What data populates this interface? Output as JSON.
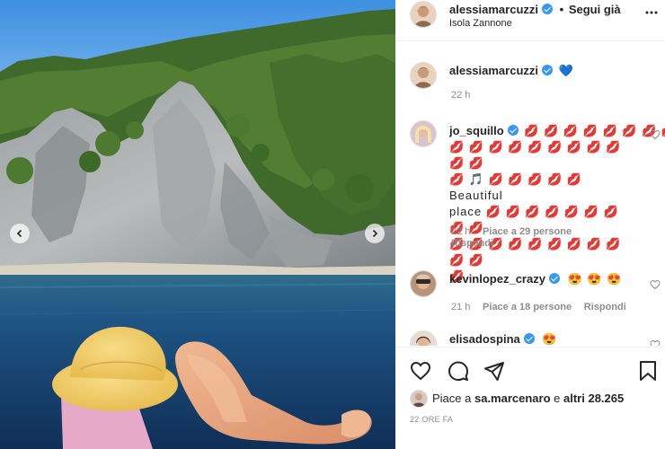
{
  "post": {
    "author": "alessiamarcuzzi",
    "follow_state": "Segui già",
    "dot": "•",
    "location": "Isola Zannone",
    "more_icon": "more-dots-icon"
  },
  "caption": {
    "author": "alessiamarcuzzi",
    "text": "💙",
    "time": "22 h"
  },
  "comments": [
    {
      "author": "jo_squillo",
      "lines": [
        "💋 💋 💋 💋 💋 💋 💋 💋",
        "💋 💋 💋 💋 💋 💋 💋 💋 💋 💋 💋",
        "💋 🎵 💋 💋 💋 💋 💋 Beautiful",
        "place 💋 💋 💋 💋 💋 💋 💋 💋 💋",
        "💋 💋 💋 💋 💋 💋 💋 💋 💋 💋 💋",
        "💋"
      ],
      "time": "22 h",
      "likes": "Piace a 29 persone",
      "reply": "Rispondi"
    },
    {
      "author": "kevinlopez_crazy",
      "text": "😍 😍 😍",
      "time": "21 h",
      "likes": "Piace a 18 persone",
      "reply": "Rispondi"
    },
    {
      "author": "elisadospina",
      "text": "😍"
    }
  ],
  "likes": {
    "prefix": "Piace a ",
    "user": "sa.marcenaro",
    "middle": " e ",
    "others": "altri 28.265"
  },
  "timestamp": "22 ORE FA",
  "colors": {
    "verified": "#3897f0",
    "text": "#262626",
    "muted": "#8e8e8e",
    "sky": "#4e9ee6",
    "sea": "#1d4b78"
  }
}
